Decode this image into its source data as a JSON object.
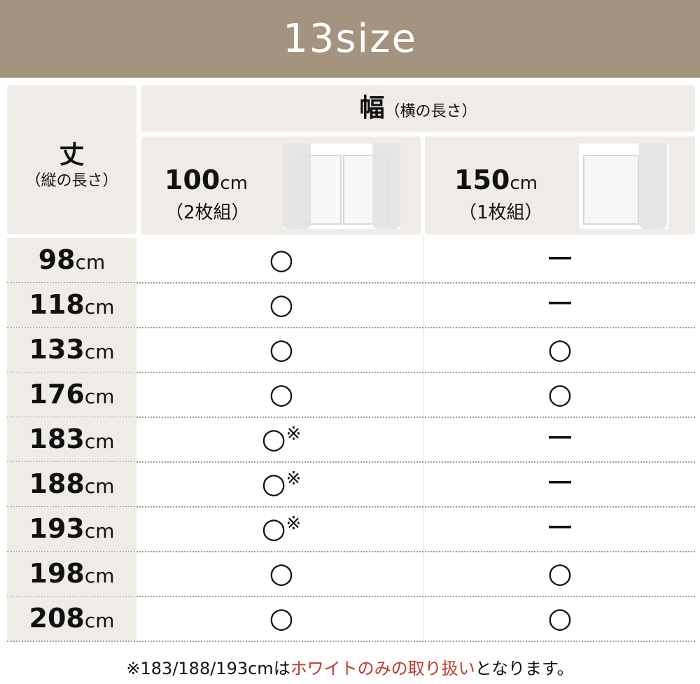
{
  "banner": {
    "title": "13size"
  },
  "header": {
    "height_label": "丈",
    "height_sub": "（縦の長さ）",
    "width_label": "幅",
    "width_sub": "（横の長さ）",
    "columns": [
      {
        "size": "100",
        "unit": "cm",
        "count": "（2枚組）"
      },
      {
        "size": "150",
        "unit": "cm",
        "count": "（1枚組）"
      }
    ]
  },
  "rows": [
    {
      "height": "98",
      "unit": "cm",
      "w100": "○",
      "w100_note": "",
      "w150": "ー"
    },
    {
      "height": "118",
      "unit": "cm",
      "w100": "○",
      "w100_note": "",
      "w150": "ー"
    },
    {
      "height": "133",
      "unit": "cm",
      "w100": "○",
      "w100_note": "",
      "w150": "○"
    },
    {
      "height": "176",
      "unit": "cm",
      "w100": "○",
      "w100_note": "",
      "w150": "○"
    },
    {
      "height": "183",
      "unit": "cm",
      "w100": "○",
      "w100_note": "※",
      "w150": "ー"
    },
    {
      "height": "188",
      "unit": "cm",
      "w100": "○",
      "w100_note": "※",
      "w150": "ー"
    },
    {
      "height": "193",
      "unit": "cm",
      "w100": "○",
      "w100_note": "※",
      "w150": "ー"
    },
    {
      "height": "198",
      "unit": "cm",
      "w100": "○",
      "w100_note": "",
      "w150": "○"
    },
    {
      "height": "208",
      "unit": "cm",
      "w100": "○",
      "w100_note": "",
      "w150": "○"
    }
  ],
  "footnote": {
    "prefix": "※183/188/193cmは",
    "highlight": "ホワイトのみの取り扱い",
    "suffix": "となります。"
  },
  "colors": {
    "banner": "#a4937e",
    "header_bg": "#efebe7",
    "highlight": "#c0392b"
  }
}
